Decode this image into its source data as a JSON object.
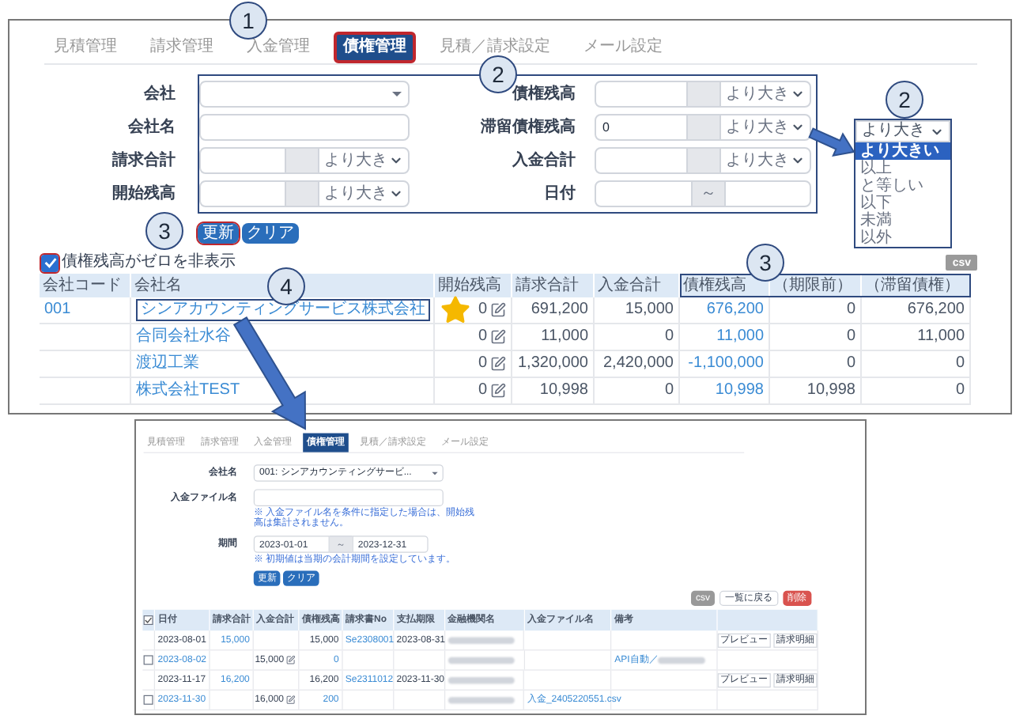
{
  "tabs": [
    {
      "label": "見積管理",
      "selected": false,
      "highlighted": false
    },
    {
      "label": "請求管理",
      "selected": false,
      "highlighted": false
    },
    {
      "label": "入金管理",
      "selected": false,
      "highlighted": false
    },
    {
      "label": "債権管理",
      "selected": true,
      "highlighted": true
    },
    {
      "label": "見積／請求設定",
      "selected": false,
      "highlighted": false
    },
    {
      "label": "メール設定",
      "selected": false,
      "highlighted": false
    }
  ],
  "filters": {
    "left": [
      {
        "label": "会社",
        "kind": "select"
      },
      {
        "label": "会社名",
        "kind": "text"
      },
      {
        "label": "請求合計",
        "kind": "compare",
        "operator": "より大き"
      },
      {
        "label": "開始残高",
        "kind": "compare",
        "operator": "より大き"
      }
    ],
    "right": [
      {
        "label": "債権残高",
        "kind": "compare",
        "operator": "より大き"
      },
      {
        "label": "滞留債権残高",
        "kind": "compare",
        "value": "0",
        "operator": "より大き"
      },
      {
        "label": "入金合計",
        "kind": "compare",
        "operator": "より大き"
      },
      {
        "label": "日付",
        "kind": "range",
        "separator": "～"
      }
    ]
  },
  "buttons": [
    {
      "label": "更新",
      "highlighted": true
    },
    {
      "label": "クリア",
      "highlighted": false
    }
  ],
  "operator_dropdown": {
    "value": "より大き",
    "options": [
      {
        "label": "より大きい",
        "selected": true
      },
      {
        "label": "以上",
        "selected": false
      },
      {
        "label": "と等しい",
        "selected": false
      },
      {
        "label": "以下",
        "selected": false
      },
      {
        "label": "未満",
        "selected": false
      },
      {
        "label": "以外",
        "selected": false
      }
    ]
  },
  "hide_zero": {
    "label": "債権残高がゼロを非表示",
    "checked": true,
    "highlighted": true
  },
  "csv_button": "csv",
  "table": {
    "columns": [
      {
        "label": "会社コード",
        "kind": "link"
      },
      {
        "label": "会社名",
        "kind": "link"
      },
      {
        "label": "開始残高",
        "kind": "edit_number"
      },
      {
        "label": "請求合計",
        "kind": "number"
      },
      {
        "label": "入金合計",
        "kind": "number"
      },
      {
        "label": "債権残高",
        "kind": "link_number"
      },
      {
        "label": "（期限前）",
        "kind": "number"
      },
      {
        "label": "（滞留債権）",
        "kind": "number"
      }
    ],
    "rows": [
      {
        "cells": [
          "001",
          "シンアカウンティングサービス株式会社",
          "0",
          "691,200",
          "15,000",
          "676,200",
          "0",
          "676,200"
        ],
        "highlighted": true,
        "starred": true
      },
      {
        "cells": [
          null,
          "合同会社水谷",
          "0",
          "11,000",
          "0",
          "11,000",
          "0",
          "11,000"
        ],
        "highlighted": false,
        "starred": false
      },
      {
        "cells": [
          null,
          "渡辺工業",
          "0",
          "1,320,000",
          "2,420,000",
          "-1,100,000",
          "0",
          "0"
        ],
        "highlighted": false,
        "starred": false
      },
      {
        "cells": [
          null,
          "株式会社TEST",
          "0",
          "10,998",
          "0",
          "10,998",
          "10,998",
          "0"
        ],
        "highlighted": false,
        "starred": false
      }
    ]
  },
  "annotations": [
    "1",
    "2",
    "2",
    "3",
    "3",
    "4"
  ],
  "detail_screen": {
    "tabs": [
      {
        "label": "見積管理",
        "selected": false
      },
      {
        "label": "請求管理",
        "selected": false
      },
      {
        "label": "入金管理",
        "selected": false
      },
      {
        "label": "債権管理",
        "selected": true
      },
      {
        "label": "見積／請求設定",
        "selected": false
      },
      {
        "label": "メール設定",
        "selected": false
      }
    ],
    "fields": [
      {
        "label": "会社名",
        "kind": "select",
        "value": "001: シンアカウンティングサービ..."
      },
      {
        "label": "入金ファイル名",
        "kind": "text",
        "note": "※ 入金ファイル名を条件に指定した場合は、開始残高は集計されません。"
      },
      {
        "label": "期間",
        "kind": "range",
        "from": "2023-01-01",
        "separator": "～",
        "to": "2023-12-31",
        "note": "※ 初期値は当期の会計期間を設定しています。"
      }
    ],
    "buttons": [
      "更新",
      "クリア"
    ],
    "actions": [
      {
        "label": "csv",
        "kind": "gray"
      },
      {
        "label": "一覧に戻る",
        "kind": "plain"
      },
      {
        "label": "削除",
        "kind": "danger"
      }
    ],
    "table": {
      "header_checked": true,
      "columns": [
        "日付",
        "請求合計",
        "入金合計",
        "債権残高",
        "請求書No",
        "支払期限",
        "金融機関名",
        "入金ファイル名",
        "備考"
      ],
      "rows": [
        {
          "cells": [
            {
              "text": "2023-08-01"
            },
            {
              "text": "15,000",
              "link": true
            },
            null,
            {
              "text": "15,000"
            },
            {
              "text": "Se2308001",
              "link": true
            },
            {
              "text": "2023-08-31"
            },
            {
              "redacted": true
            },
            null,
            null
          ],
          "actions": [
            "プレビュー",
            "請求明細"
          ]
        },
        {
          "checked": false,
          "cells": [
            {
              "text": "2023-08-02",
              "link": true
            },
            null,
            {
              "text": "15,000",
              "edit": true
            },
            {
              "text": "0",
              "link": true
            },
            null,
            null,
            {
              "redacted": true
            },
            null,
            {
              "text": "API自動／",
              "link": true,
              "redacted": true
            }
          ]
        },
        {
          "cells": [
            {
              "text": "2023-11-17"
            },
            {
              "text": "16,200",
              "link": true
            },
            null,
            {
              "text": "16,200"
            },
            {
              "text": "Se2311012",
              "link": true
            },
            {
              "text": "2023-11-30"
            },
            {
              "redacted": true
            },
            null,
            null
          ],
          "actions": [
            "プレビュー",
            "請求明細"
          ]
        },
        {
          "checked": false,
          "cells": [
            {
              "text": "2023-11-30",
              "link": true
            },
            null,
            {
              "text": "16,000",
              "edit": true
            },
            {
              "text": "200",
              "link": true
            },
            null,
            null,
            {
              "redacted": true
            },
            {
              "text": "入金_2405220551.csv",
              "link": true
            },
            null
          ]
        }
      ]
    }
  }
}
